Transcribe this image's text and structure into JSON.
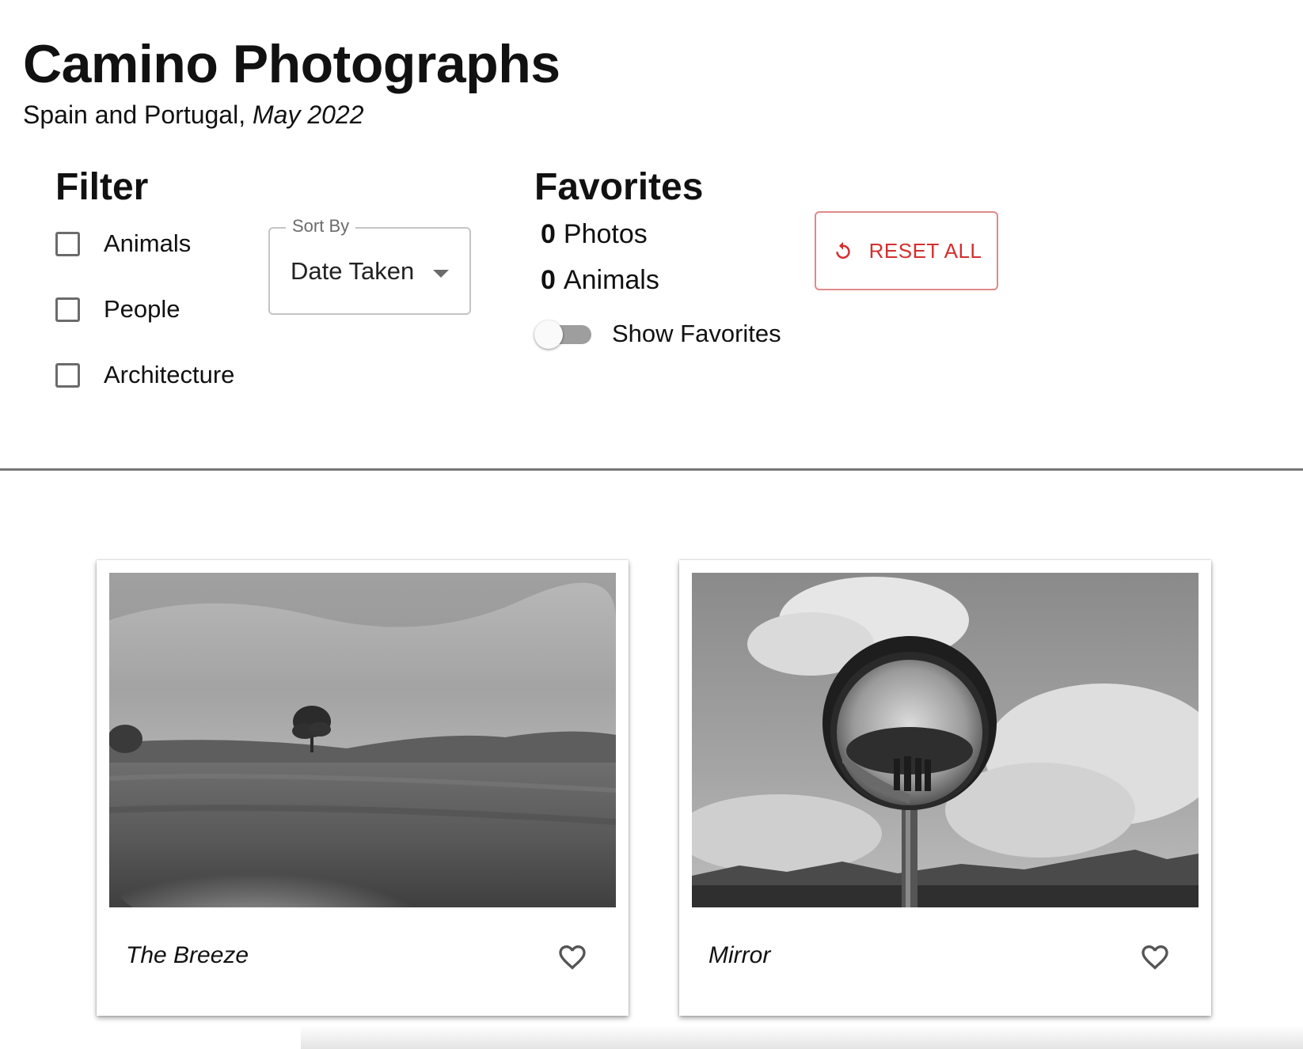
{
  "header": {
    "title": "Camino Photographs",
    "subtitle_plain": "Spain and Portugal,",
    "subtitle_italic": "May 2022"
  },
  "filter": {
    "heading": "Filter",
    "checkboxes": [
      {
        "label": "Animals",
        "checked": false
      },
      {
        "label": "People",
        "checked": false
      },
      {
        "label": "Architecture",
        "checked": false
      }
    ],
    "sort": {
      "legend": "Sort By",
      "value": "Date Taken",
      "caret_icon": "arrow-drop-down-icon"
    }
  },
  "favorites": {
    "heading": "Favorites",
    "photos_count": "0",
    "photos_label": "Photos",
    "animals_count": "0",
    "animals_label": "Animals",
    "toggle_label": "Show Favorites",
    "toggle_on": false
  },
  "reset": {
    "label": "RESET ALL",
    "icon": "restart-icon",
    "color": "#d32f2f"
  },
  "photos": [
    {
      "caption": "The Breeze",
      "image": "grassland-tree-photo",
      "favorite": false
    },
    {
      "caption": "Mirror",
      "image": "convex-mirror-photo",
      "favorite": false
    }
  ]
}
